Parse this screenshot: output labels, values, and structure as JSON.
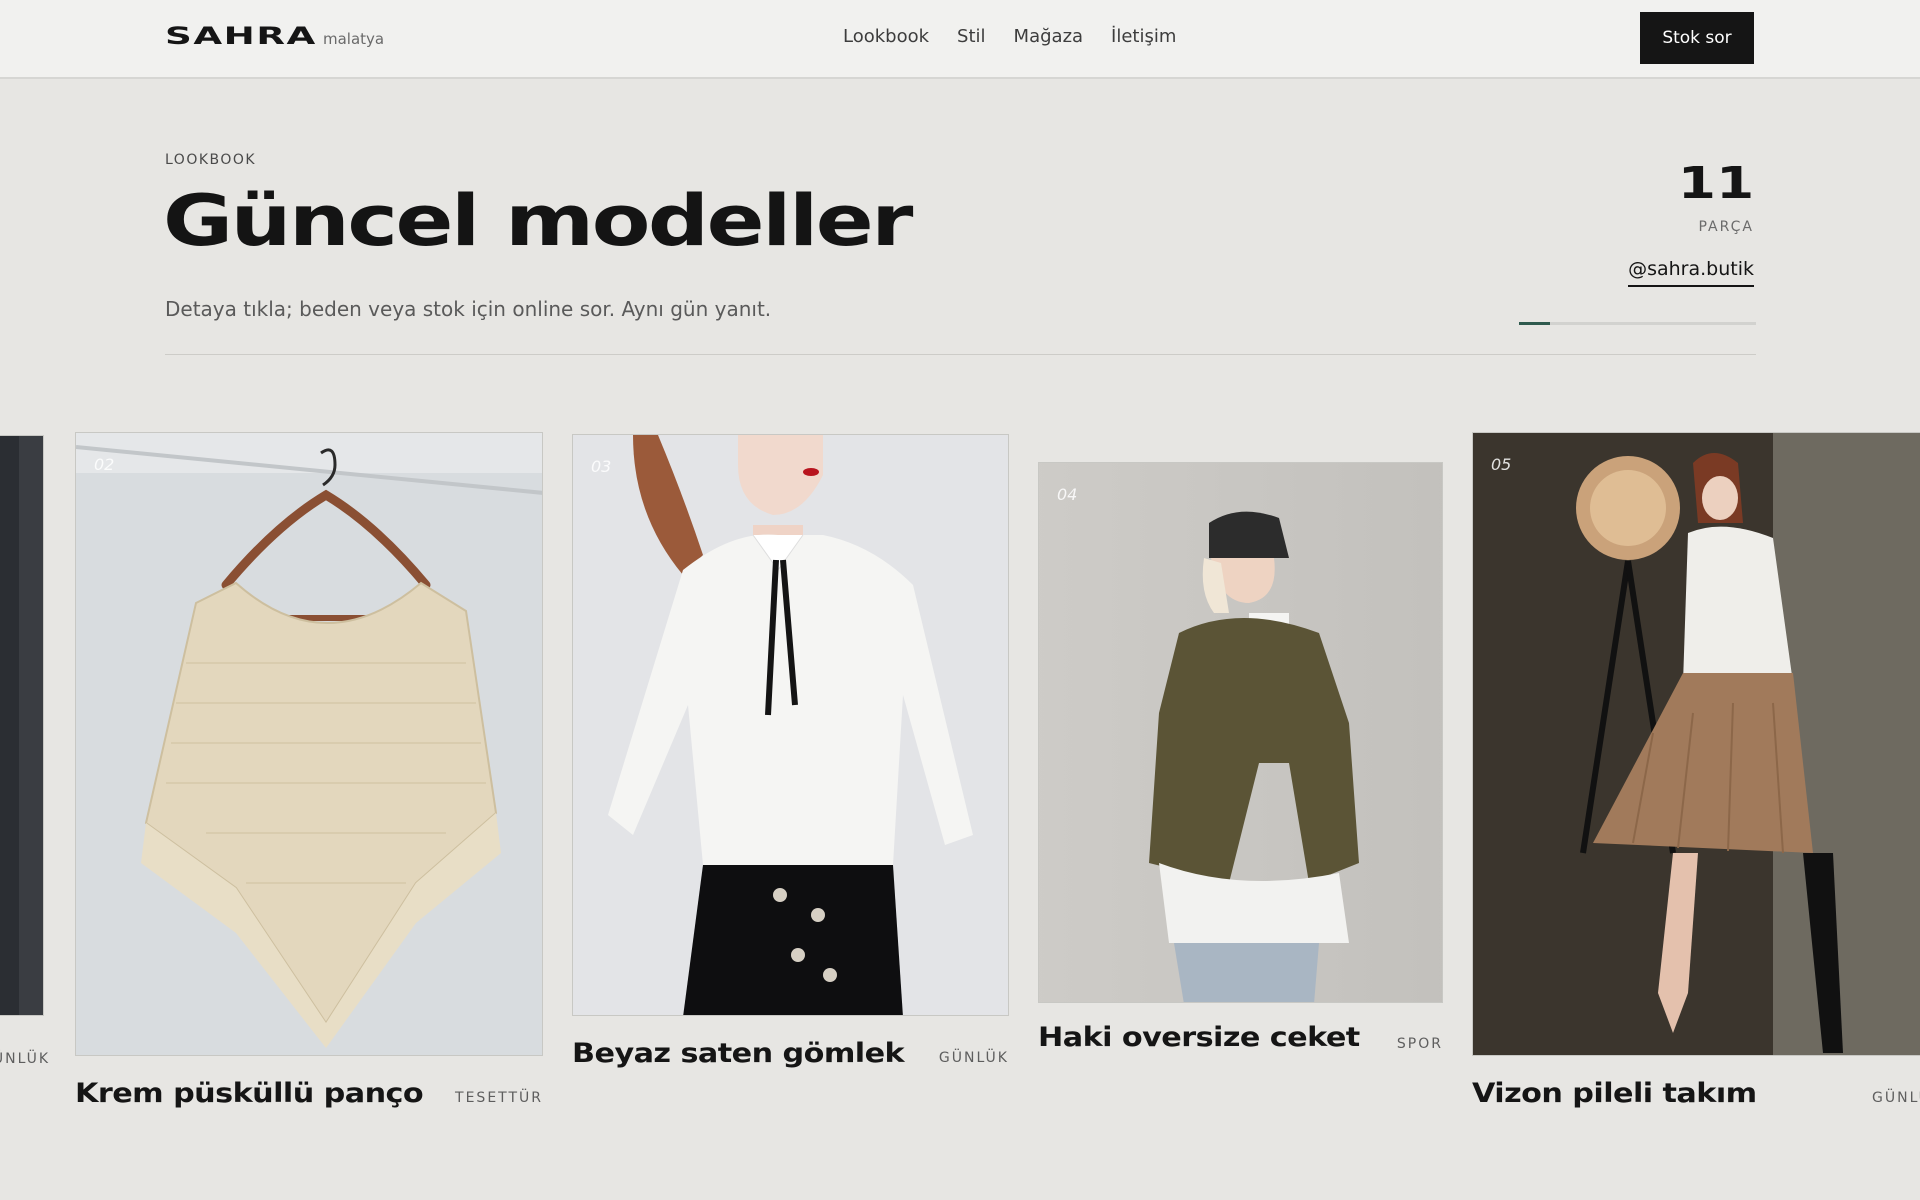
{
  "header": {
    "brand": "SAHRA",
    "city": "malatya",
    "nav": [
      "Lookbook",
      "Stil",
      "Mağaza",
      "İletişim"
    ],
    "cta": "Stok sor"
  },
  "hero": {
    "eyebrow": "LOOKBOOK",
    "title": "Güncel modeller",
    "subtitle": "Detaya tıkla; beden veya stok için online sor. Aynı gün yanıt.",
    "count": "11",
    "count_label": "PARÇA",
    "handle": "@sahra.butik",
    "progress": 0.13,
    "accent_color": "#2f5a4e"
  },
  "cards": [
    {
      "num": "",
      "name": "",
      "category": "GÜNLÜK",
      "image": "dark-garment-photo"
    },
    {
      "num": "02",
      "name": "Krem püsküllü panço",
      "category": "TESETTÜR",
      "image": "cream-fringe-poncho-on-hanger-photo"
    },
    {
      "num": "03",
      "name": "Beyaz saten gömlek",
      "category": "GÜNLÜK",
      "image": "white-satin-blouse-black-skirt-photo"
    },
    {
      "num": "04",
      "name": "Haki oversize ceket",
      "category": "SPOR",
      "image": "khaki-oversize-jacket-beanie-photo"
    },
    {
      "num": "05",
      "name": "Vizon pileli takım",
      "category": "GÜNLÜK",
      "image": "mink-pleated-skirt-studio-photo"
    }
  ]
}
